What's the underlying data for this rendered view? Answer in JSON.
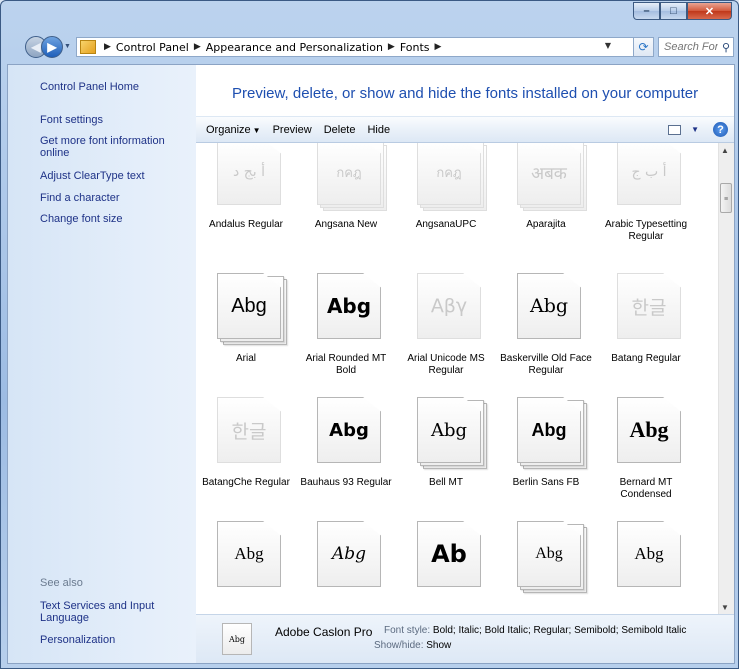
{
  "window": {
    "caption_buttons": {
      "minimize": "–",
      "maximize": "□",
      "close": "✕"
    }
  },
  "address_bar": {
    "crumbs": [
      "Control Panel",
      "Appearance and Personalization",
      "Fonts"
    ],
    "search_placeholder": "Search Fonts"
  },
  "sidebar": {
    "home": "Control Panel Home",
    "links": [
      "Font settings",
      "Get more font information online",
      "Adjust ClearType text",
      "Find a character",
      "Change font size"
    ],
    "see_also_label": "See also",
    "see_also_links": [
      "Text Services and Input Language",
      "Personalization"
    ]
  },
  "main": {
    "title": "Preview, delete, or show and hide the fonts installed on your computer"
  },
  "toolbar": {
    "organize": "Organize",
    "preview": "Preview",
    "delete": "Delete",
    "hide": "Hide"
  },
  "fonts": [
    {
      "name": "Andalus Regular",
      "sample": "أ بج د",
      "hidden": true,
      "family": false
    },
    {
      "name": "Angsana New",
      "sample": "กคฎ",
      "hidden": true,
      "family": true
    },
    {
      "name": "AngsanaUPC",
      "sample": "กคฎ",
      "hidden": true,
      "family": true
    },
    {
      "name": "Aparajita",
      "sample": "अबक",
      "hidden": true,
      "family": true
    },
    {
      "name": "Arabic Typesetting Regular",
      "sample": "أ ب ج",
      "hidden": true,
      "family": false
    },
    {
      "name": "Arial",
      "sample": "Abg",
      "hidden": false,
      "family": true
    },
    {
      "name": "Arial Rounded MT Bold",
      "sample": "Abg",
      "hidden": false,
      "family": false
    },
    {
      "name": "Arial Unicode MS Regular",
      "sample": "Αβγ",
      "hidden": true,
      "family": false
    },
    {
      "name": "Baskerville Old Face Regular",
      "sample": "Abg",
      "hidden": false,
      "family": false
    },
    {
      "name": "Batang Regular",
      "sample": "한글",
      "hidden": true,
      "family": false
    },
    {
      "name": "BatangChe Regular",
      "sample": "한글",
      "hidden": true,
      "family": false
    },
    {
      "name": "Bauhaus 93 Regular",
      "sample": "Abg",
      "hidden": false,
      "family": false
    },
    {
      "name": "Bell MT",
      "sample": "Abg",
      "hidden": false,
      "family": true
    },
    {
      "name": "Berlin Sans FB",
      "sample": "Abg",
      "hidden": false,
      "family": true
    },
    {
      "name": "Bernard MT Condensed",
      "sample": "Abg",
      "hidden": false,
      "family": false
    },
    {
      "name": "",
      "sample": "Abg",
      "hidden": false,
      "family": false
    },
    {
      "name": "",
      "sample": "Abg",
      "hidden": false,
      "family": false
    },
    {
      "name": "",
      "sample": "Ab",
      "hidden": false,
      "family": false
    },
    {
      "name": "",
      "sample": "Abg",
      "hidden": false,
      "family": true
    },
    {
      "name": "",
      "sample": "Abg",
      "hidden": false,
      "family": false
    }
  ],
  "details": {
    "thumb_sample": "Abg",
    "name": "Adobe Caslon Pro",
    "style_label": "Font style:",
    "style_value": "Bold; Italic; Bold Italic; Regular; Semibold; Semibold Italic",
    "showhide_label": "Show/hide:",
    "showhide_value": "Show"
  }
}
